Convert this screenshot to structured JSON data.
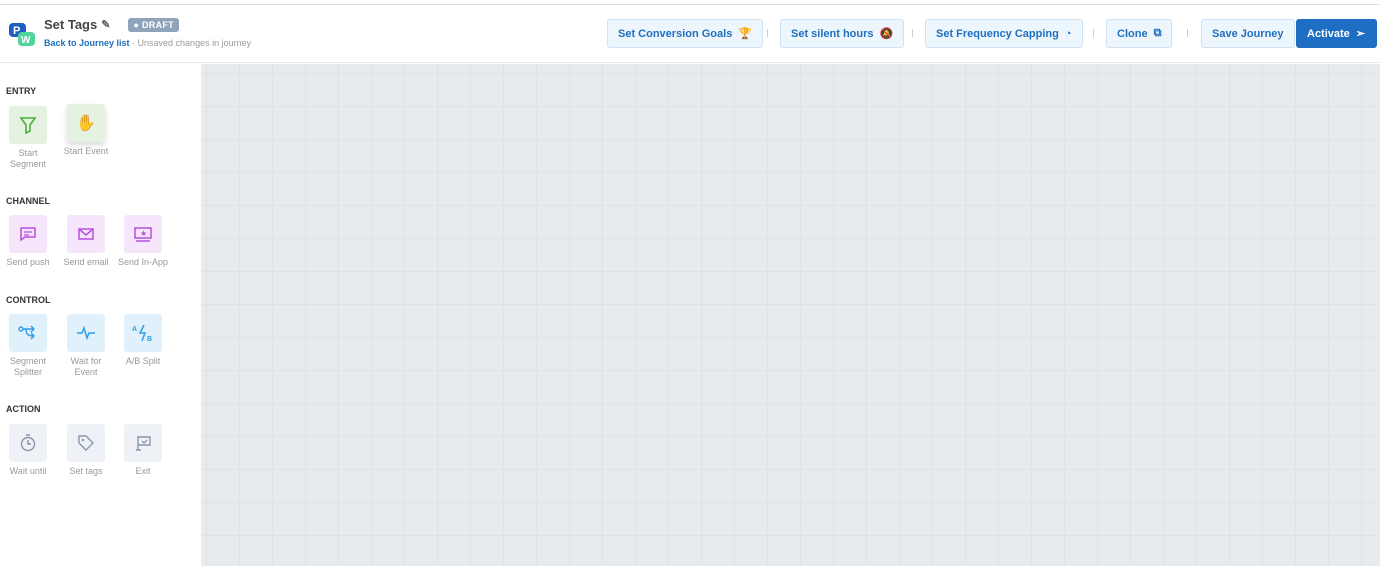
{
  "header": {
    "title": "Set Tags",
    "status": "DRAFT",
    "back_link": "Back to Journey list",
    "unsaved": " · Unsaved changes in journey",
    "buttons": {
      "conversion": "Set Conversion Goals",
      "silent": "Set silent hours",
      "frequency": "Set Frequency Capping",
      "clone": "Clone",
      "save": "Save Journey",
      "activate": "Activate"
    }
  },
  "colors": {
    "primary": "#1e6fc3",
    "entry": "#4caf3a",
    "channel": "#b64fe0",
    "control": "#2d9de6",
    "action": "#8898ad"
  },
  "sidebar": {
    "sections": {
      "entry": "ENTRY",
      "channel": "CHANNEL",
      "control": "CONTROL",
      "action": "ACTION"
    },
    "items": {
      "start_segment": "Start Segment",
      "start_event": "Start Event",
      "send_push": "Send push",
      "send_email": "Send email",
      "send_inapp": "Send In-App",
      "segment_splitter": "Segment Splitter",
      "wait_event": "Wait for Event",
      "ab_split": "A/B Split",
      "wait_until": "Wait until",
      "set_tags": "Set tags",
      "exit": "Exit"
    }
  }
}
